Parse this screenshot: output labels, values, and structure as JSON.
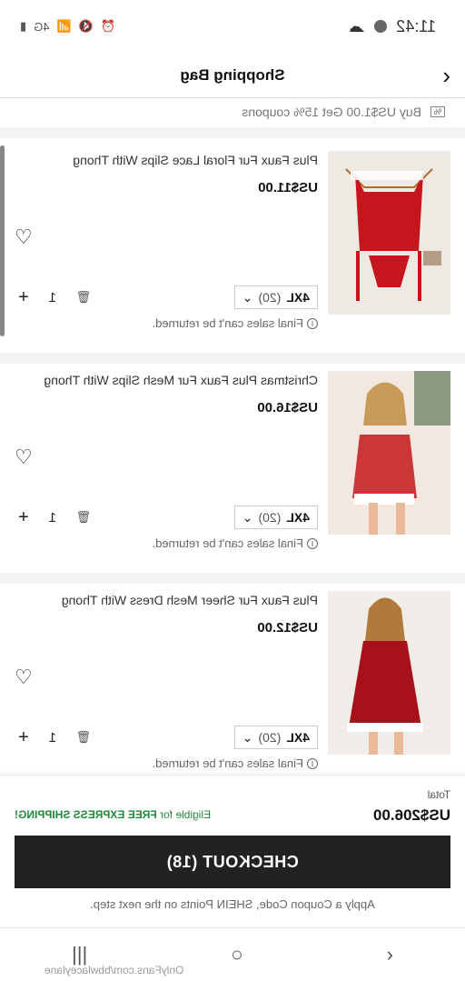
{
  "status": {
    "time": "11:42",
    "icons_text": "4G"
  },
  "header": {
    "title": "Shopping Bag"
  },
  "coupon": {
    "tag": "%",
    "text": "Buy US$1.00 Get 15% coupons"
  },
  "items": [
    {
      "name": "Plus Faux Fur Floral Lace Slips With Thong",
      "price": "US$11.00",
      "size": "4XL",
      "size_count": "(20)",
      "qty": "1",
      "note": "Final sales can't be returned."
    },
    {
      "name": "Christmas Plus Faux Fur Mesh Slips With Thong",
      "price": "US$16.00",
      "size": "4XL",
      "size_count": "(20)",
      "qty": "1",
      "note": "Final sales can't be returned."
    },
    {
      "name": "Plus Faux Fur Sheer Mesh Dress With Thong",
      "price": "US$12.00",
      "size": "4XL",
      "size_count": "(20)",
      "qty": "1",
      "note": "Final sales can't be returned."
    }
  ],
  "footer": {
    "total_label": "Total",
    "total_value": "US$206.00",
    "shipping_prefix": "Eligible for",
    "shipping_bold": "FREE EXPRESS SHIPPING!",
    "checkout_label": "CHECKOUT (18)",
    "hint": "Apply a Coupon Code, SHEIN Points on the next step."
  },
  "watermark": "OnlyFans.com/bbwlaceylane",
  "colors": {
    "shipping_green": "#1f8a3a",
    "checkout_bg": "#222222",
    "product_red": "#c4161c"
  }
}
